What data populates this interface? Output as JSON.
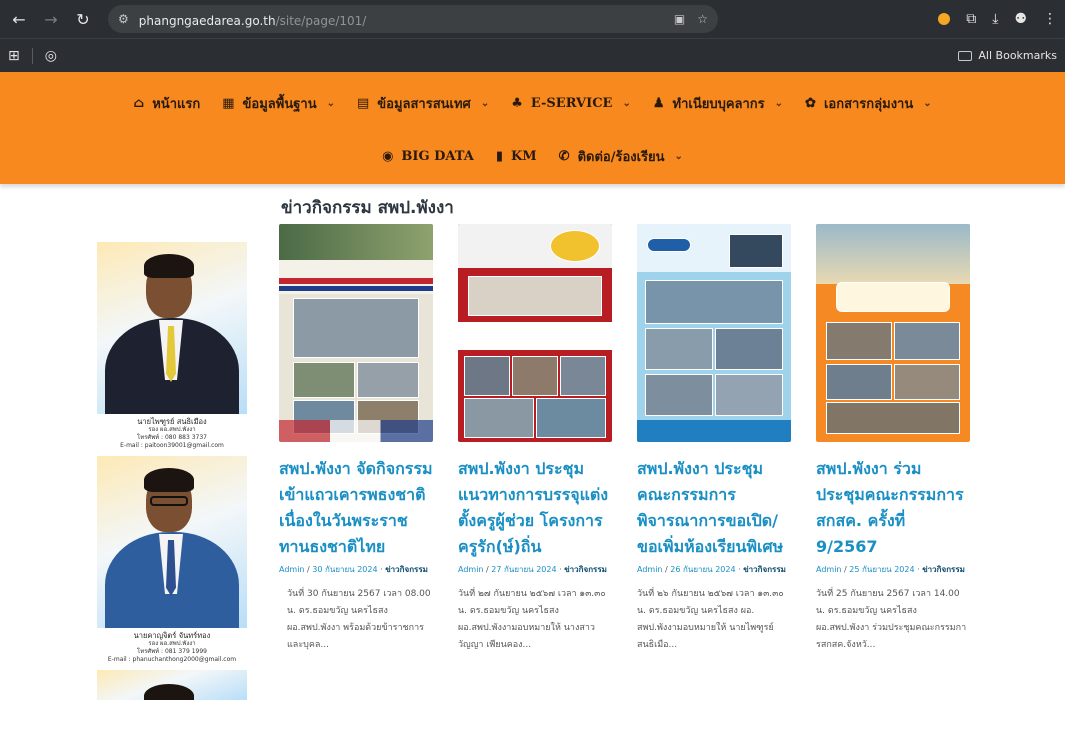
{
  "browser": {
    "url_host": "phangngaedarea.go.th",
    "url_path": "/site/page/101/",
    "all_bookmarks_label": "All Bookmarks"
  },
  "nav": {
    "row1": [
      {
        "icon": "home-icon",
        "glyph": "⌂",
        "label": "หน้าแรก",
        "has_caret": false
      },
      {
        "icon": "database-icon",
        "glyph": "▦",
        "label": "ข้อมูลพื้นฐาน",
        "has_caret": true
      },
      {
        "icon": "document-icon",
        "glyph": "▤",
        "label": "ข้อมูลสารสนเทศ",
        "has_caret": true
      },
      {
        "icon": "sitemap-icon",
        "glyph": "♣",
        "label": "E-SERVICE",
        "has_caret": true
      },
      {
        "icon": "users-icon",
        "glyph": "♟",
        "label": "ทำเนียบบุคลากร",
        "has_caret": true
      },
      {
        "icon": "folder-icon",
        "glyph": "✿",
        "label": "เอกสารกลุ่มงาน",
        "has_caret": true
      }
    ],
    "row2": [
      {
        "icon": "globe-icon",
        "glyph": "◉",
        "label": "BIG DATA",
        "has_caret": false
      },
      {
        "icon": "book-icon",
        "glyph": "▮",
        "label": "KM",
        "has_caret": false
      },
      {
        "icon": "phone-icon",
        "glyph": "✆",
        "label": "ติดต่อ/ร้องเรียน",
        "has_caret": true
      }
    ]
  },
  "section_title": "ข่าวกิจกรรม สพป.พังงา",
  "sidebar": {
    "people": [
      {
        "name": "นายไพฑูรย์ สนธิเมือง",
        "position": "รอง ผอ.สพป.พังงา",
        "phone": "โทรศัพท์ : 080 883 3737",
        "email": "E-mail : paitoon39001@gmail.com"
      },
      {
        "name": "นายคาญจิตร์ จันทร์ทอง",
        "position": "รอง ผอ.สพป.พังงา",
        "phone": "โทรศัพท์ : 081 379 1999",
        "email": "E-mail : phanuchanthong2000@gmail.com"
      }
    ]
  },
  "news": [
    {
      "title": "สพป.พังงา จัดกิจกรรมเข้าแถวเคารพธงชาติ เนื่องในวันพระราชทานธงชาติไทย",
      "author": "Admin",
      "date": "30 กันยายน 2024",
      "category": "ข่าวกิจกรรม",
      "excerpt": "วันที่ 30 กันยายน 2567 เวลา 08.00 น. ดร.ธอมขวัญ นครไธสง ผอ.สพป.พังงา พร้อมด้วยข้าราชการและบุคล..."
    },
    {
      "title": "สพป.พังงา ประชุมแนวทางการบรรจุแต่งตั้งครูผู้ช่วย โครงการครูรัก(ษ์)ถิ่น",
      "author": "Admin",
      "date": "27 กันยายน 2024",
      "category": "ข่าวกิจกรรม",
      "excerpt": "วันที่ ๒๗ กันยายน ๒๕๖๗ เวลา ๑๓.๓๐ น. ดร.ธอมขวัญ นครไธสง ผอ.สพป.พังงามอบหมายให้ นางสาววัญญา เพียนคอง..."
    },
    {
      "title": "สพป.พังงา ประชุมคณะกรรมการพิจารณาการขอเปิด/ขอเพิ่มห้องเรียนพิเศษ",
      "author": "Admin",
      "date": "26 กันยายน 2024",
      "category": "ข่าวกิจกรรม",
      "excerpt": "วันที่ ๒๖ กันยายน ๒๕๖๗ เวลา ๑๓.๓๐ น. ดร.ธอมขวัญ นครไธสง ผอ. สพป.พังงามอบหมายให้ นายไพฑูรย์ สนธิเมือ..."
    },
    {
      "title": "สพป.พังงา ร่วมประชุมคณะกรรมการ สกสค. ครั้งที่ 9/2567",
      "author": "Admin",
      "date": "25 กันยายน 2024",
      "category": "ข่าวกิจกรรม",
      "excerpt": "วันที่ 25 กันยายน 2567 เวลา 14.00 น. ดร.ธอมขวัญ นครไธสง ผอ.สพป.พังงา ร่วมประชุมคณะกรรมการสกสค.จังหวั..."
    }
  ]
}
